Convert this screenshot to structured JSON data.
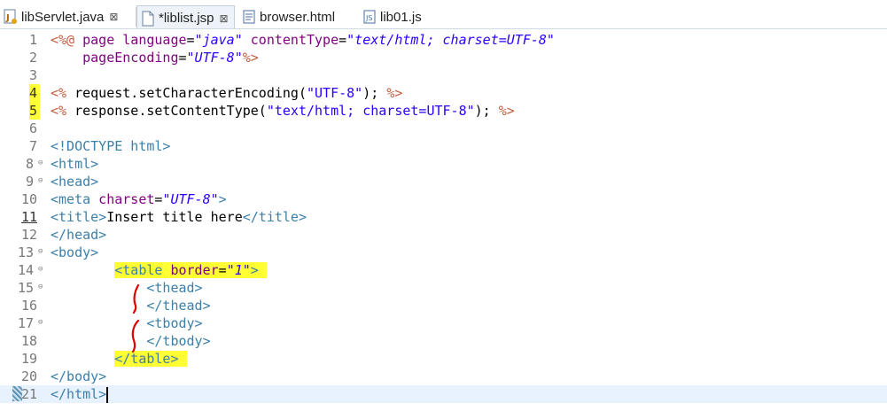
{
  "tabs": [
    {
      "label": "libServlet.java",
      "close": "⊠",
      "icon": "java-file-icon"
    },
    {
      "label": "*liblist.jsp",
      "close": "⊠",
      "icon": "jsp-file-icon"
    },
    {
      "label": "browser.html",
      "icon": "html-file-icon"
    },
    {
      "label": "lib01.js",
      "icon": "js-file-icon"
    }
  ],
  "lines": [
    {
      "n": "1"
    },
    {
      "n": "2"
    },
    {
      "n": "3"
    },
    {
      "n": "4"
    },
    {
      "n": "5"
    },
    {
      "n": "6"
    },
    {
      "n": "7"
    },
    {
      "n": "8"
    },
    {
      "n": "9"
    },
    {
      "n": "10"
    },
    {
      "n": "11"
    },
    {
      "n": "12"
    },
    {
      "n": "13"
    },
    {
      "n": "14"
    },
    {
      "n": "15"
    },
    {
      "n": "16"
    },
    {
      "n": "17"
    },
    {
      "n": "18"
    },
    {
      "n": "19"
    },
    {
      "n": "20"
    },
    {
      "n": "21"
    }
  ],
  "code": {
    "l1": {
      "open": "<%@",
      "page": " page ",
      "a1": "language",
      "eq1": "=",
      "v1": "\"java\"",
      "a2": " contentType",
      "eq2": "=",
      "v2": "\"text/html; charset=UTF-8\""
    },
    "l2": {
      "indent": "    ",
      "a": "pageEncoding",
      "eq": "=",
      "v": "\"UTF-8\"",
      "close": "%>"
    },
    "l4": {
      "open": "<%",
      "body": " request.setCharacterEncoding(",
      "s": "\"UTF-8\"",
      "end": "); ",
      "close": "%>"
    },
    "l5": {
      "open": "<%",
      "body": " response.setContentType(",
      "s": "\"text/html; charset=UTF-8\"",
      "end": "); ",
      "close": "%>"
    },
    "l7": {
      "t": "<!DOCTYPE html>"
    },
    "l8": {
      "t": "<html>"
    },
    "l9": {
      "t": "<head>"
    },
    "l10": {
      "t": "<meta",
      "a": " charset",
      "eq": "=",
      "v": "\"UTF-8\"",
      "c": ">"
    },
    "l11": {
      "t1": "<title>",
      "text": "Insert title here",
      "t2": "</title>"
    },
    "l12": {
      "t": "</head>"
    },
    "l13": {
      "t": "<body>"
    },
    "l14": {
      "indent": "        ",
      "t": "<table",
      "a": " border",
      "eq": "=",
      "v": "\"1\"",
      "c": ">"
    },
    "l15": {
      "indent": "            ",
      "t": "<thead>"
    },
    "l16": {
      "indent": "            ",
      "t": "</thead>"
    },
    "l17": {
      "indent": "            ",
      "t": "<tbody>"
    },
    "l18": {
      "indent": "            ",
      "t": "</tbody>"
    },
    "l19": {
      "indent": "        ",
      "t": "</table>"
    },
    "l20": {
      "t": "</body>"
    },
    "l21": {
      "t": "</html>"
    }
  },
  "colors": {
    "tag": "#3c7fa8",
    "jsp_delim": "#bf5f3f",
    "attr": "#7f007f",
    "string": "#2a00ff",
    "highlight": "#ffff33",
    "annotation": "#e00000"
  }
}
